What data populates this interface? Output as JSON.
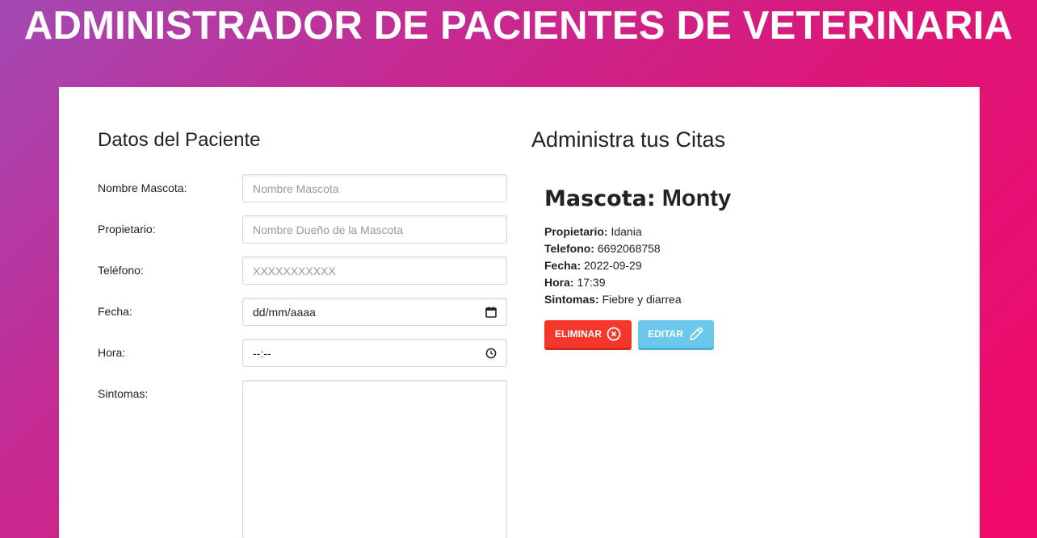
{
  "header": {
    "title": "ADMINISTRADOR DE PACIENTES DE VETERINARIA"
  },
  "form": {
    "title": "Datos del Paciente",
    "fields": [
      {
        "label": "Nombre Mascota:",
        "placeholder": "Nombre Mascota",
        "value": ""
      },
      {
        "label": "Propietario:",
        "placeholder": "Nombre Dueño de la Mascota",
        "value": ""
      },
      {
        "label": "Teléfono:",
        "placeholder": "XXXXXXXXXXX",
        "value": ""
      },
      {
        "label": "Fecha:",
        "placeholder": "dd/mm/aaaa",
        "value": ""
      },
      {
        "label": "Hora:",
        "placeholder": "--:--",
        "value": ""
      },
      {
        "label": "Sintomas:",
        "placeholder": "",
        "value": ""
      }
    ]
  },
  "list": {
    "title": "Administra tus Citas",
    "appointments": [
      {
        "pet_label": "Mascota:",
        "pet_name": "Monty",
        "owner_label": "Propietario:",
        "owner": "Idania",
        "phone_label": "Telefono:",
        "phone": "6692068758",
        "date_label": "Fecha:",
        "date": "2022-09-29",
        "time_label": "Hora:",
        "time": "17:39",
        "symptoms_label": "Sintomas:",
        "symptoms": "Fiebre y diarrea",
        "delete_label": "Eliminar",
        "edit_label": "Editar"
      }
    ]
  },
  "icons": {
    "delete": "x-circle-icon",
    "edit": "pencil-icon",
    "date": "calendar-icon",
    "time": "clock-icon"
  },
  "colors": {
    "delete": "#f5372b",
    "edit": "#6cc7ec",
    "gradient_start": "#a349b4",
    "gradient_end": "#f20a6b"
  }
}
